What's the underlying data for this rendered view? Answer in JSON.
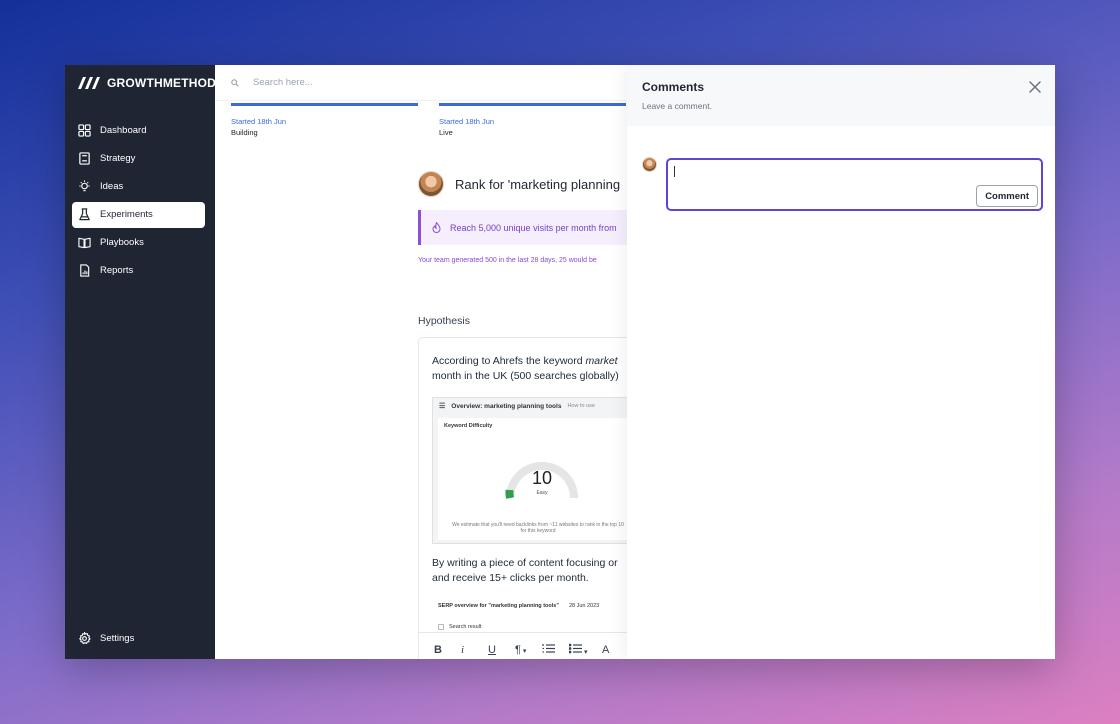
{
  "app": {
    "logo_text": "GROWTHMETHOD"
  },
  "sidebar": {
    "items": [
      {
        "label": "Dashboard",
        "icon": "grid-icon"
      },
      {
        "label": "Strategy",
        "icon": "book-icon"
      },
      {
        "label": "Ideas",
        "icon": "lightbulb-icon"
      },
      {
        "label": "Experiments",
        "icon": "flask-icon",
        "active": true
      },
      {
        "label": "Playbooks",
        "icon": "open-book-icon"
      },
      {
        "label": "Reports",
        "icon": "report-icon"
      }
    ],
    "settings_label": "Settings"
  },
  "search": {
    "placeholder": "Search here..."
  },
  "stages": [
    {
      "date": "Started 18th Jun",
      "name": "Building"
    },
    {
      "date": "Started 18th Jun",
      "name": "Live"
    }
  ],
  "experiment": {
    "title": "Rank for 'marketing planning",
    "goal": "Reach 5,000 unique visits per month from",
    "note": "Your team generated 500 in the last 28 days, 25 would be",
    "hypothesis_label": "Hypothesis",
    "hypothesis_line1_prefix": "According to Ahrefs the keyword ",
    "hypothesis_line1_keyword": "market",
    "hypothesis_line2": "month in the UK (500 searches globally)",
    "screenshot": {
      "title": "Overview: marketing planning tools",
      "how_to": "How to use",
      "kd_label": "Keyword Difficulty",
      "kd_value": "10",
      "kd_level": "Easy",
      "kd_note_line1": "We estimate that you'll need backlinks from ~11 websites to rank in the top 10",
      "kd_note_line2": "for this keyword"
    },
    "para2_line1": "By writing a piece of content focusing or",
    "para2_line2": "and receive 15+ clicks per month.",
    "serp_title": "SERP overview for \"marketing planning tools\"",
    "serp_date": "28 Jun 2023",
    "serp_sub": "Search result"
  },
  "toolbar": {
    "bold": "B",
    "italic": "i",
    "underline": "U",
    "paragraph": "¶",
    "numbered": "ol",
    "bulleted": "ul",
    "text_size": "A"
  },
  "comments": {
    "title": "Comments",
    "subtitle": "Leave a comment.",
    "input_value": "",
    "button_label": "Comment"
  },
  "colors": {
    "accent": "#3b6bd6",
    "purple": "#8e4fd8",
    "focus": "#5b46d6",
    "sidebar": "#1f2533"
  }
}
